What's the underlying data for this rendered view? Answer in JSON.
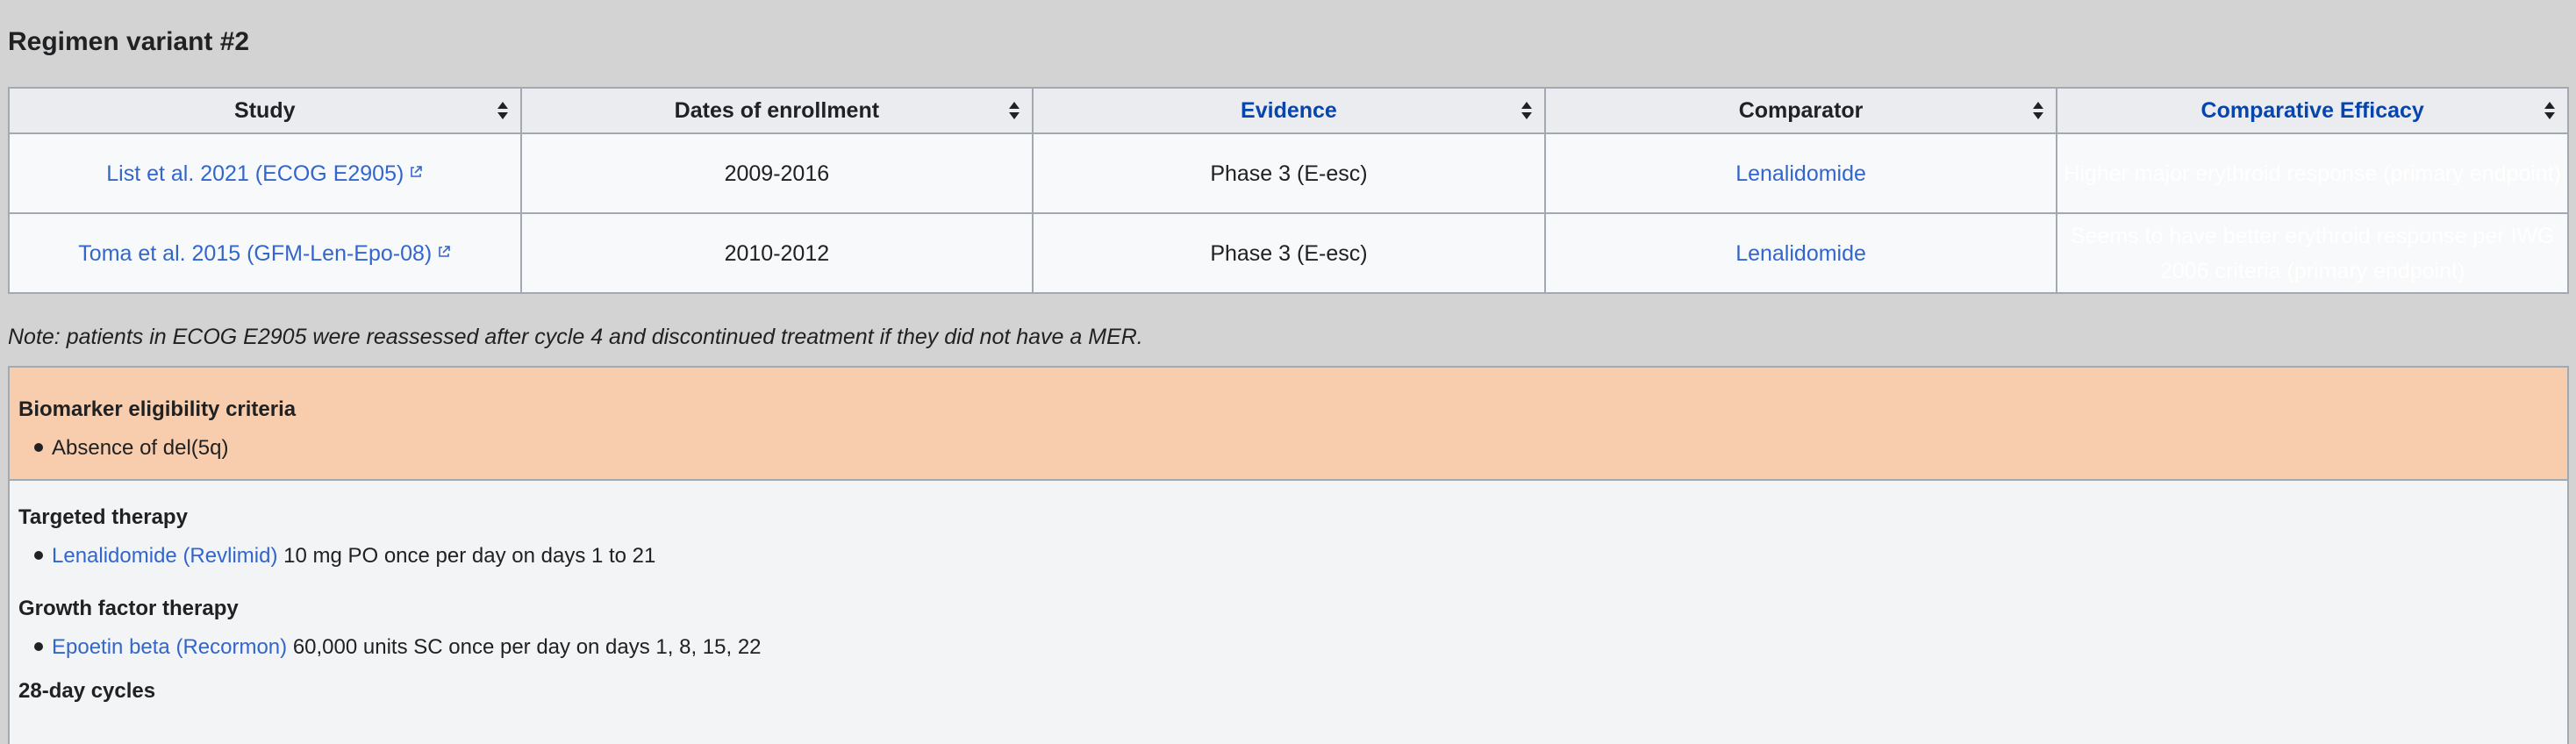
{
  "section": {
    "title": "Regimen variant #2"
  },
  "table": {
    "headers": {
      "study": "Study",
      "dates": "Dates of enrollment",
      "evidence": "Evidence",
      "comparator": "Comparator",
      "efficacy": "Comparative Efficacy"
    },
    "rows": [
      {
        "study": "List et al. 2021 (ECOG E2905)",
        "dates": "2009-2016",
        "evidence": "Phase 3 (E-esc)",
        "comparator": "Lenalidomide",
        "efficacy": "Higher major erythroid response (primary endpoint)"
      },
      {
        "study": "Toma et al. 2015 (GFM-Len-Epo-08)",
        "dates": "2010-2012",
        "evidence": "Phase 3 (E-esc)",
        "comparator": "Lenalidomide",
        "efficacy": "Seems to have better erythroid response per IWG 2006 criteria (primary endpoint)"
      }
    ]
  },
  "note": "Note: patients in ECOG E2905 were reassessed after cycle 4 and discontinued treatment if they did not have a MER.",
  "biomarker": {
    "title": "Biomarker eligibility criteria",
    "items": [
      "Absence of del(5q)"
    ]
  },
  "targeted": {
    "title": "Targeted therapy",
    "drug_link": "Lenalidomide (Revlimid)",
    "dose": "10 mg PO once per day on days 1 to 21"
  },
  "growth": {
    "title": "Growth factor therapy",
    "drug_link": "Epoetin beta (Recormon)",
    "dose": "60,000 units SC once per day on days 1, 8, 15, 22"
  },
  "cycles": "28-day cycles",
  "colors": {
    "evidence_green": "#489957",
    "efficacy_dark": "#133174",
    "efficacy_mid": "#4466b9",
    "biomarker_bg": "#f8cdad",
    "link": "#3366cc"
  }
}
